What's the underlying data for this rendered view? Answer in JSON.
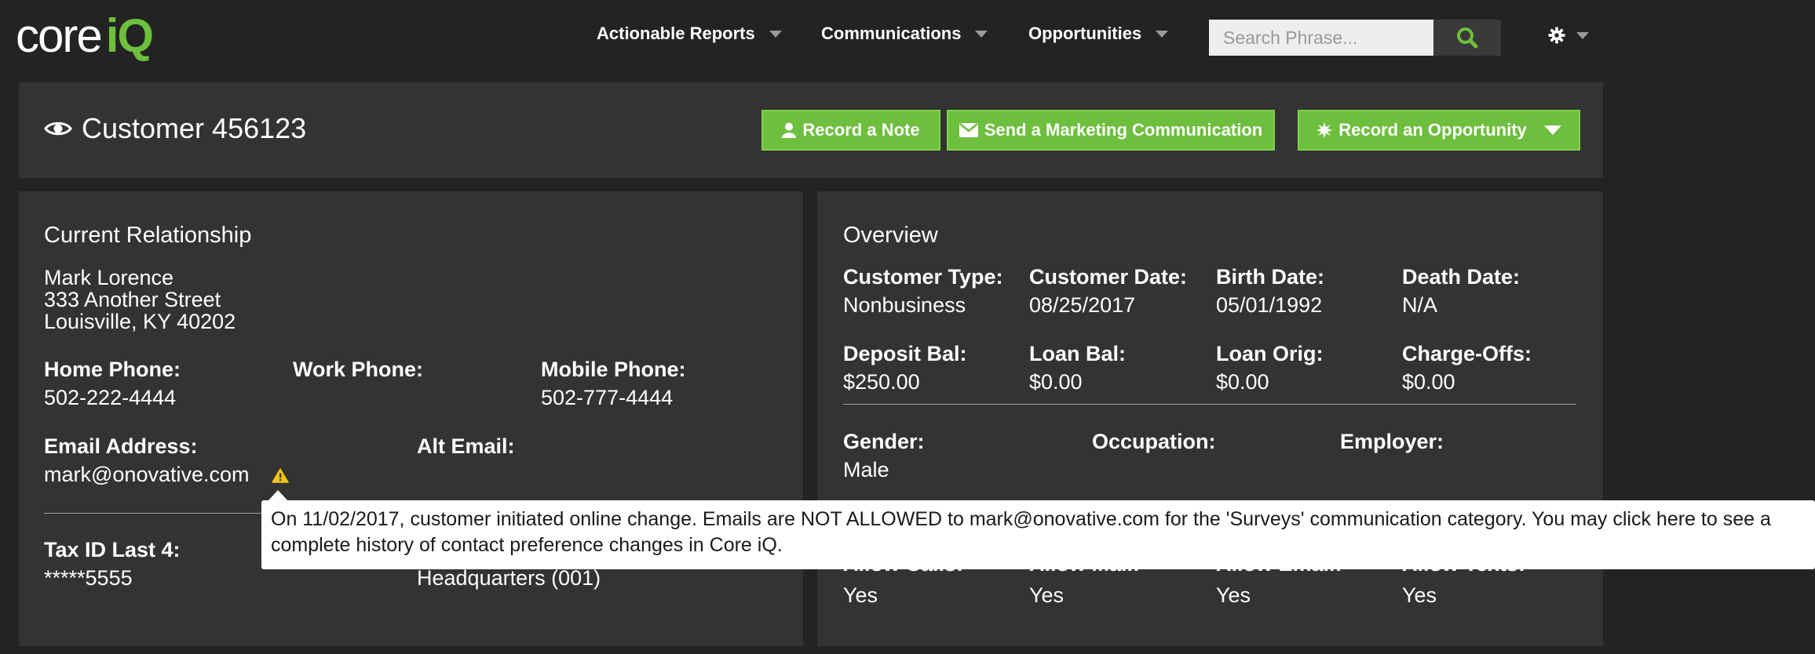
{
  "logo": {
    "core": "core",
    "iq": "iQ"
  },
  "nav": {
    "items": [
      {
        "label": "Actionable Reports"
      },
      {
        "label": "Communications"
      },
      {
        "label": "Opportunities"
      }
    ],
    "search_placeholder": "Search Phrase..."
  },
  "header": {
    "title": "Customer 456123",
    "buttons": {
      "note": "Record a Note",
      "communication": "Send a Marketing Communication",
      "opportunity": "Record an Opportunity"
    }
  },
  "relationship": {
    "title": "Current Relationship",
    "name": "Mark Lorence",
    "street": "333 Another Street",
    "city": "Louisville, KY 40202",
    "home_phone_label": "Home Phone:",
    "home_phone": "502-222-4444",
    "work_phone_label": "Work Phone:",
    "mobile_phone_label": "Mobile Phone:",
    "mobile_phone": "502-777-4444",
    "email_label": "Email Address:",
    "email": "mark@onovative.com",
    "alt_email_label": "Alt Email:",
    "tax_id_label": "Tax ID Last 4:",
    "tax_id": "*****5555",
    "branch": "Headquarters (001)"
  },
  "overview": {
    "title": "Overview",
    "row1": [
      {
        "label": "Customer Type:",
        "value": "Nonbusiness"
      },
      {
        "label": "Customer Date:",
        "value": "08/25/2017"
      },
      {
        "label": "Birth Date:",
        "value": "05/01/1992"
      },
      {
        "label": "Death Date:",
        "value": "N/A"
      }
    ],
    "row2": [
      {
        "label": "Deposit Bal:",
        "value": "$250.00"
      },
      {
        "label": "Loan Bal:",
        "value": "$0.00"
      },
      {
        "label": "Loan Orig:",
        "value": "$0.00"
      },
      {
        "label": "Charge-Offs:",
        "value": "$0.00"
      }
    ],
    "row3": [
      {
        "label": "Gender:",
        "value": "Male"
      },
      {
        "label": "Occupation:",
        "value": ""
      },
      {
        "label": "Employer:",
        "value": ""
      }
    ],
    "row4": [
      {
        "label": "Allow Calls:",
        "value": "Yes"
      },
      {
        "label": "Allow Mail:",
        "value": "Yes"
      },
      {
        "label": "Allow Email:",
        "value": "Yes"
      },
      {
        "label": "Allow Texts:",
        "value": "Yes"
      }
    ]
  },
  "tooltip": {
    "text": "On 11/02/2017, customer initiated online change. Emails are NOT ALLOWED to mark@onovative.com for the 'Surveys' communication category. You may click here to see a complete history of contact preference changes in Core iQ."
  },
  "colors": {
    "accent": "#6dbf3d",
    "background": "#232323",
    "panel": "#333333",
    "warning": "#f0c419"
  },
  "icons": {
    "search": "search-icon",
    "settings": "gear-icon",
    "title": "eye-icon",
    "note": "user-icon",
    "communication": "envelope-icon",
    "opportunity": "burst-icon",
    "warning": "warning-icon"
  }
}
